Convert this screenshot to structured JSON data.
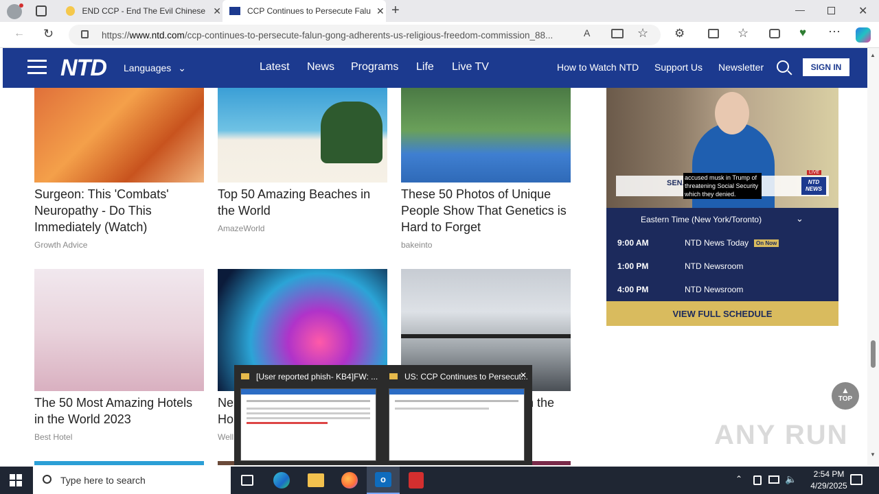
{
  "browser": {
    "tabs": [
      {
        "title": "END CCP - End The Evil Chinese",
        "active": false
      },
      {
        "title": "CCP Continues to Persecute Falu",
        "active": true
      }
    ],
    "url_prefix": "https://",
    "url_domain": "www.ntd.com",
    "url_path": "/ccp-continues-to-persecute-falun-gong-adherents-us-religious-freedom-commission_88..."
  },
  "nav": {
    "logo": "NTD",
    "languages": "Languages",
    "links": [
      "Latest",
      "News",
      "Programs",
      "Life",
      "Live TV"
    ],
    "right_links": [
      "How to Watch NTD",
      "Support Us",
      "Newsletter"
    ],
    "signin": "SIGN IN"
  },
  "cards": [
    {
      "title": "Surgeon: This 'Combats' Neuropathy - Do This Immediately (Watch)",
      "source": "Growth Advice"
    },
    {
      "title": "Top 50 Amazing Beaches in the World",
      "source": "AmazeWorld"
    },
    {
      "title": "These 50 Photos of Unique People Show That Genetics is Hard to Forget",
      "source": "bakeinto"
    },
    {
      "title": "The 50 Most Amazing Hotels in the World 2023",
      "source": "Best Hotel"
    },
    {
      "title": "Neu",
      "title2": "Hou",
      "title_tail": "t)",
      "source": "Well"
    },
    {
      "title_tail": "in the",
      "source": ""
    }
  ],
  "video": {
    "lower_third": "SEN.",
    "caption": "accused musk in Trump of threatening Social Security which they denied.",
    "badge": "NTD NEWS",
    "live": "LIVE"
  },
  "schedule": {
    "timezone": "Eastern Time (New York/Toronto)",
    "rows": [
      {
        "time": "9:00 AM",
        "show": "NTD News Today",
        "badge": "On Now"
      },
      {
        "time": "1:00 PM",
        "show": "NTD Newsroom",
        "badge": ""
      },
      {
        "time": "4:00 PM",
        "show": "NTD Newsroom",
        "badge": ""
      }
    ],
    "view_full": "VIEW FULL SCHEDULE"
  },
  "top_button": "TOP",
  "watermark": "ANY RUN",
  "popup": {
    "items": [
      {
        "title": "[User reported phish- KB4]FW: ..."
      },
      {
        "title": "US: CCP Continues to Persecut..."
      }
    ]
  },
  "taskbar": {
    "search_placeholder": "Type here to search",
    "time": "2:54 PM",
    "date": "4/29/2025"
  }
}
